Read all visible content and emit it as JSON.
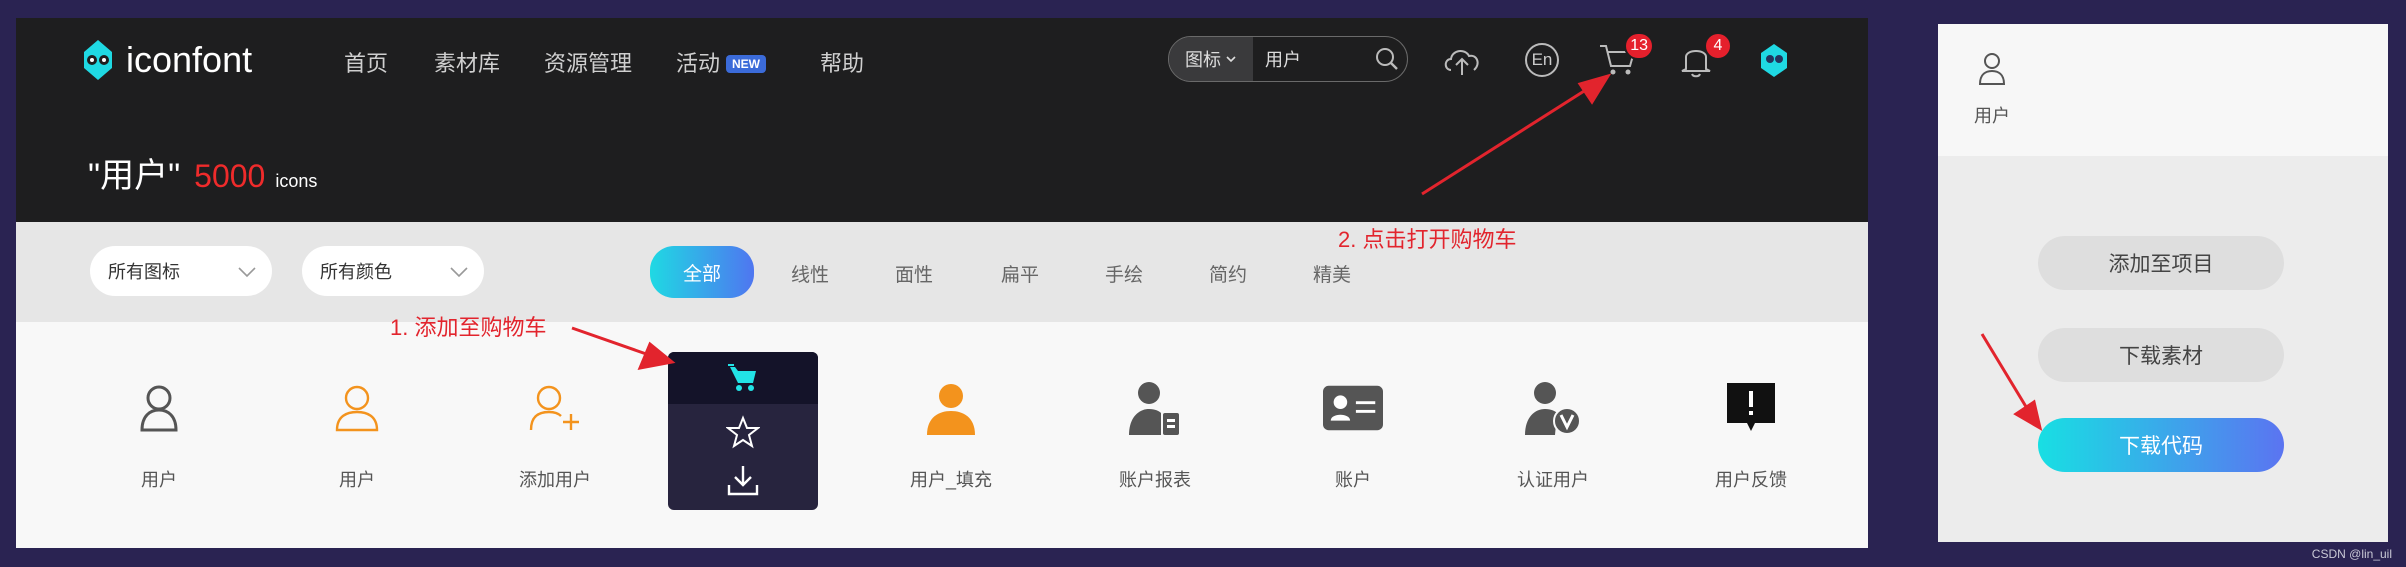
{
  "colors": {
    "accent_red": "#e5202c",
    "gradient_start": "#1fd9e3",
    "gradient_end": "#4f76f0",
    "orange_icon": "#f3931d",
    "hover_cart": "#22e3e6"
  },
  "header": {
    "logo_text": "iconfont",
    "nav": [
      "首页",
      "素材库",
      "资源管理",
      "活动",
      "帮助"
    ],
    "new_badge": "NEW",
    "search_type": "图标",
    "search_value": "用户",
    "lang_label": "En",
    "cart_count": "13",
    "notification_count": "4"
  },
  "result": {
    "query": "\"用户\"",
    "count": "5000",
    "unit": "icons"
  },
  "filters": {
    "icon_filter": "所有图标",
    "color_filter": "所有颜色",
    "tabs": [
      "全部",
      "线性",
      "面性",
      "扁平",
      "手绘",
      "简约",
      "精美"
    ]
  },
  "icons": [
    {
      "label": "用户",
      "icon": "user-outline-icon"
    },
    {
      "label": "用户",
      "icon": "user-orange-outline-icon"
    },
    {
      "label": "添加用户",
      "icon": "add-user-icon"
    },
    {
      "label": "",
      "icon": "hover-actions-card"
    },
    {
      "label": "用户_填充",
      "icon": "user-filled-orange-icon"
    },
    {
      "label": "账户报表",
      "icon": "account-report-icon"
    },
    {
      "label": "账户",
      "icon": "account-card-icon"
    },
    {
      "label": "认证用户",
      "icon": "verified-user-icon"
    },
    {
      "label": "用户反馈",
      "icon": "user-feedback-icon"
    }
  ],
  "right_panel": {
    "item_label": "用户",
    "buttons": [
      "添加至项目",
      "下载素材",
      "下载代码"
    ]
  },
  "annotations": {
    "step1": "1. 添加至购物车",
    "step2": "2. 点击打开购物车"
  },
  "watermark": "CSDN @lin_uil"
}
